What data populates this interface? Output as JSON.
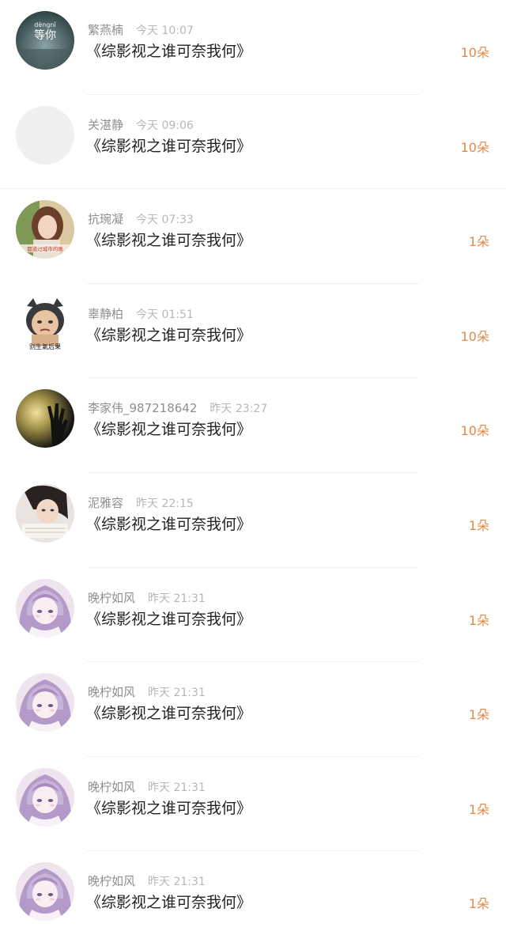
{
  "colors": {
    "accent": "#e28a46",
    "name": "#8e8e8e",
    "time": "#b7b7b7",
    "message": "#222222",
    "divider": "#efefef"
  },
  "items": [
    {
      "name": "繁燕楠",
      "time": "今天 10:07",
      "message": "《综影视之谁可奈我何》",
      "gift": "10朵",
      "avatar": "avatar-dengni"
    },
    {
      "name": "关湛静",
      "time": "今天 09:06",
      "message": "《综影视之谁可奈我何》",
      "gift": "10朵",
      "avatar": "avatar-blank"
    },
    {
      "name": "抗琬凝",
      "time": "今天 07:33",
      "message": "《综影视之谁可奈我何》",
      "gift": "1朵",
      "avatar": "avatar-girl-photo"
    },
    {
      "name": "辜静柏",
      "time": "今天 01:51",
      "message": "《综影视之谁可奈我何》",
      "gift": "10朵",
      "avatar": "avatar-meme-cat"
    },
    {
      "name": "李家伟_987218642",
      "time": "昨天 23:27",
      "message": "《综影视之谁可奈我何》",
      "gift": "10朵",
      "avatar": "avatar-hand-light"
    },
    {
      "name": "泥雅容",
      "time": "昨天 22:15",
      "message": "《综影视之谁可奈我何》",
      "gift": "1朵",
      "avatar": "avatar-girl-reading"
    },
    {
      "name": "晚柠如风",
      "time": "昨天 21:31",
      "message": "《综影视之谁可奈我何》",
      "gift": "1朵",
      "avatar": "avatar-anime-girl"
    },
    {
      "name": "晚柠如风",
      "time": "昨天 21:31",
      "message": "《综影视之谁可奈我何》",
      "gift": "1朵",
      "avatar": "avatar-anime-girl"
    },
    {
      "name": "晚柠如风",
      "time": "昨天 21:31",
      "message": "《综影视之谁可奈我何》",
      "gift": "1朵",
      "avatar": "avatar-anime-girl"
    },
    {
      "name": "晚柠如风",
      "time": "昨天 21:31",
      "message": "《综影视之谁可奈我何》",
      "gift": "1朵",
      "avatar": "avatar-anime-girl"
    }
  ],
  "avatar_text": {
    "dengni_small": "dèngnǐ",
    "dengni_big": "等你",
    "girl_photo_caption": "都道过城市的晚",
    "meme_caption": "别生氣后果",
    "dengni_note": ""
  }
}
